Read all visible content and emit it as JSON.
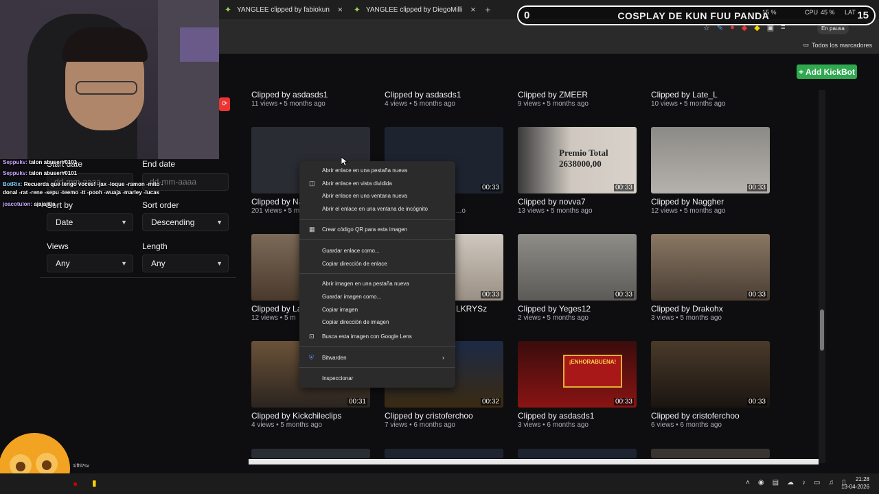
{
  "browser": {
    "tabs": [
      {
        "label": "YANGLEE clipped by fabiokun"
      },
      {
        "label": "YANGLEE clipped by DiegoMilli"
      }
    ],
    "new_tab": "+",
    "pause_label": "En pausa",
    "bookmarks_label": "Todos los marcadores"
  },
  "overlay": {
    "counter_left": "0",
    "title": "COSPLAY DE KUN FUU PANDA",
    "counter_right": "15",
    "cpu_label": "CPU",
    "cpu_value": "45 %",
    "other_value": "15 %",
    "lat_label": "LAT"
  },
  "page": {
    "add_button": "+ Add KickBot",
    "filters": {
      "start_label": "Start date",
      "end_label": "End date",
      "start_placeholder": "dd-mm-aaaa",
      "end_placeholder": "dd-mm-aaaa",
      "sort_by_label": "Sort by",
      "sort_order_label": "Sort order",
      "sort_by_value": "Date",
      "sort_order_value": "Descending",
      "views_label": "Views",
      "length_label": "Length",
      "views_value": "Any",
      "length_value": "Any"
    },
    "clips_row0": [
      {
        "title": "Clipped by asdasds1",
        "meta": "11 views • 5 months ago"
      },
      {
        "title": "Clipped by asdasds1",
        "meta": "4 views • 5 months ago"
      },
      {
        "title": "Clipped by ZMEER",
        "meta": "9 views • 5 months ago"
      },
      {
        "title": "Clipped by Late_L",
        "meta": "10 views • 5 months ago"
      }
    ],
    "clips_row1": [
      {
        "title": "Clipped by Na",
        "meta": "201 views • 5 m",
        "duration": ""
      },
      {
        "title": "",
        "meta": "...o",
        "duration": "00:33"
      },
      {
        "title": "Clipped by novva7",
        "meta": "13 views • 5 months ago",
        "duration": "00:33"
      },
      {
        "title": "Clipped by Naggher",
        "meta": "12 views • 5 months ago",
        "duration": "00:33"
      }
    ],
    "clips_row2": [
      {
        "title": "Clipped by La",
        "meta": "12 views • 5 m",
        "duration": ""
      },
      {
        "title": "LKRYSz",
        "meta": "",
        "duration": "00:33"
      },
      {
        "title": "Clipped by Yeges12",
        "meta": "2 views • 5 months ago",
        "duration": "00:33"
      },
      {
        "title": "Clipped by Drakohx",
        "meta": "3 views • 5 months ago",
        "duration": "00:33"
      }
    ],
    "clips_row3": [
      {
        "title": "Clipped by Kickchileclips",
        "meta": "4 views • 5 months ago",
        "duration": "00:31"
      },
      {
        "title": "Clipped by cristoferchoo",
        "meta": "7 views • 6 months ago",
        "duration": "00:32"
      },
      {
        "title": "Clipped by asdasds1",
        "meta": "3 views • 6 months ago",
        "duration": "00:33"
      },
      {
        "title": "Clipped by cristoferchoo",
        "meta": "6 views • 6 months ago",
        "duration": "00:33"
      }
    ],
    "thumb_texts": {
      "jackpot": "Premio Total 2638000,00",
      "enhorabuena": "¡ENHORABUENA!"
    }
  },
  "context_menu": {
    "items": [
      "Abrir enlace en una pestaña nueva",
      "Abrir enlace en vista dividida",
      "Abrir enlace en una ventana nueva",
      "Abrir el enlace en una ventana de incógnito",
      "Crear código QR para esta imagen",
      "Guardar enlace como...",
      "Copiar dirección de enlace",
      "Abrir imagen en una pestaña nueva",
      "Guardar imagen como...",
      "Copiar imagen",
      "Copiar dirección de imagen",
      "Busca esta imagen con Google Lens",
      "Bitwarden",
      "Inspeccionar"
    ]
  },
  "chat": {
    "lines": [
      {
        "user": "Seppukv:",
        "text": "talon abuser#0101"
      },
      {
        "user": "Seppukv:",
        "text": "talon abuser#0101"
      },
      {
        "user": "BotRix:",
        "text": "Recuerda que tengo voces! -jax -loque -ramon -mito -"
      },
      {
        "user": "",
        "text": "donal -rat -rene -sepu -teemo -tt -pooh -wuaja -marley -lucas"
      },
      {
        "user": "joacotulon:",
        "text": "ajajajaja"
      }
    ],
    "small_label": "1ifhl7sv"
  },
  "taskbar": {
    "time": "21:28",
    "date": "13-04-2026"
  }
}
